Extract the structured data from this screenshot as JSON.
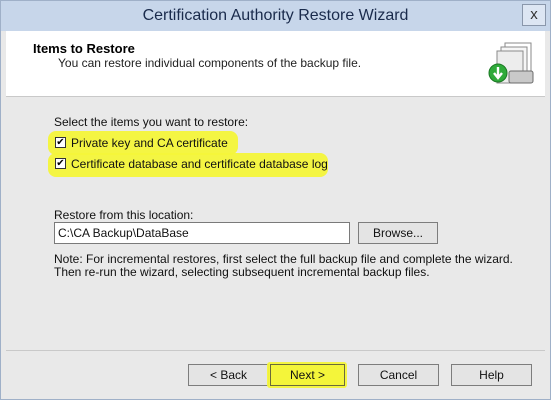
{
  "window": {
    "title": "Certification Authority Restore Wizard",
    "close_glyph": "x"
  },
  "header": {
    "title": "Items to Restore",
    "subtitle": "You can restore individual components of the backup file.",
    "icon": "backup-restore-icon"
  },
  "body": {
    "select_label": "Select the items you want to restore:",
    "items": [
      {
        "label": "Private key and CA certificate",
        "checked": true
      },
      {
        "label": "Certificate database and certificate database log",
        "checked": true
      }
    ],
    "location_label": "Restore from this location:",
    "location_value": "C:\\CA Backup\\DataBase",
    "browse_label": "Browse...",
    "note_line1": "Note: For incremental restores, first select the full backup file and complete the wizard.",
    "note_line2": "Then re-run the wizard, selecting subsequent incremental backup files.",
    "highlight_color": "#f4f53a"
  },
  "footer": {
    "back": "< Back",
    "next": "Next >",
    "cancel": "Cancel",
    "help": "Help"
  }
}
